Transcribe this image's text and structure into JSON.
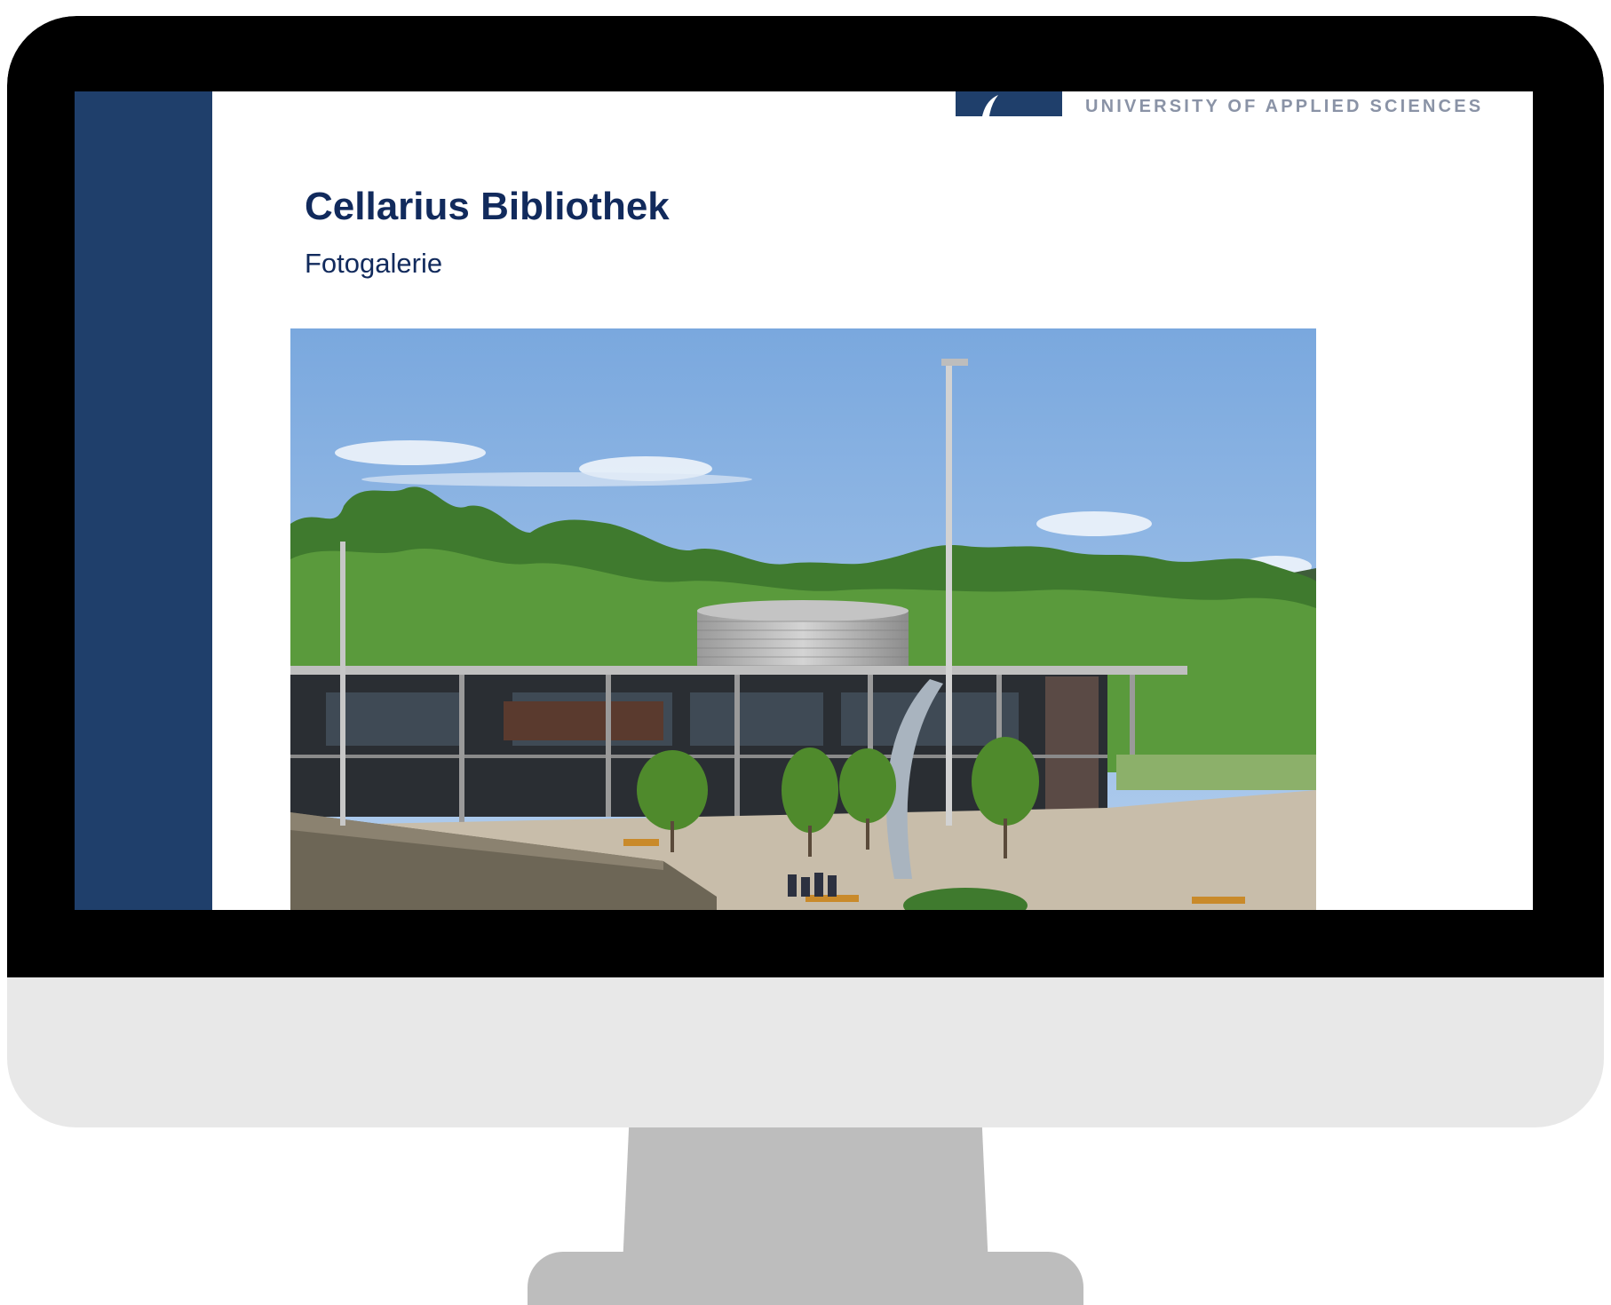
{
  "header": {
    "university_text": "UNIVERSITY OF APPLIED SCIENCES"
  },
  "page": {
    "title": "Cellarius Bibliothek",
    "subtitle": "Fotogalerie"
  },
  "colors": {
    "sidebar": "#1f3f6b",
    "title": "#112a5c",
    "bezel": "#000000",
    "chin": "#e8e8e8",
    "stand": "#bdbdbd"
  }
}
